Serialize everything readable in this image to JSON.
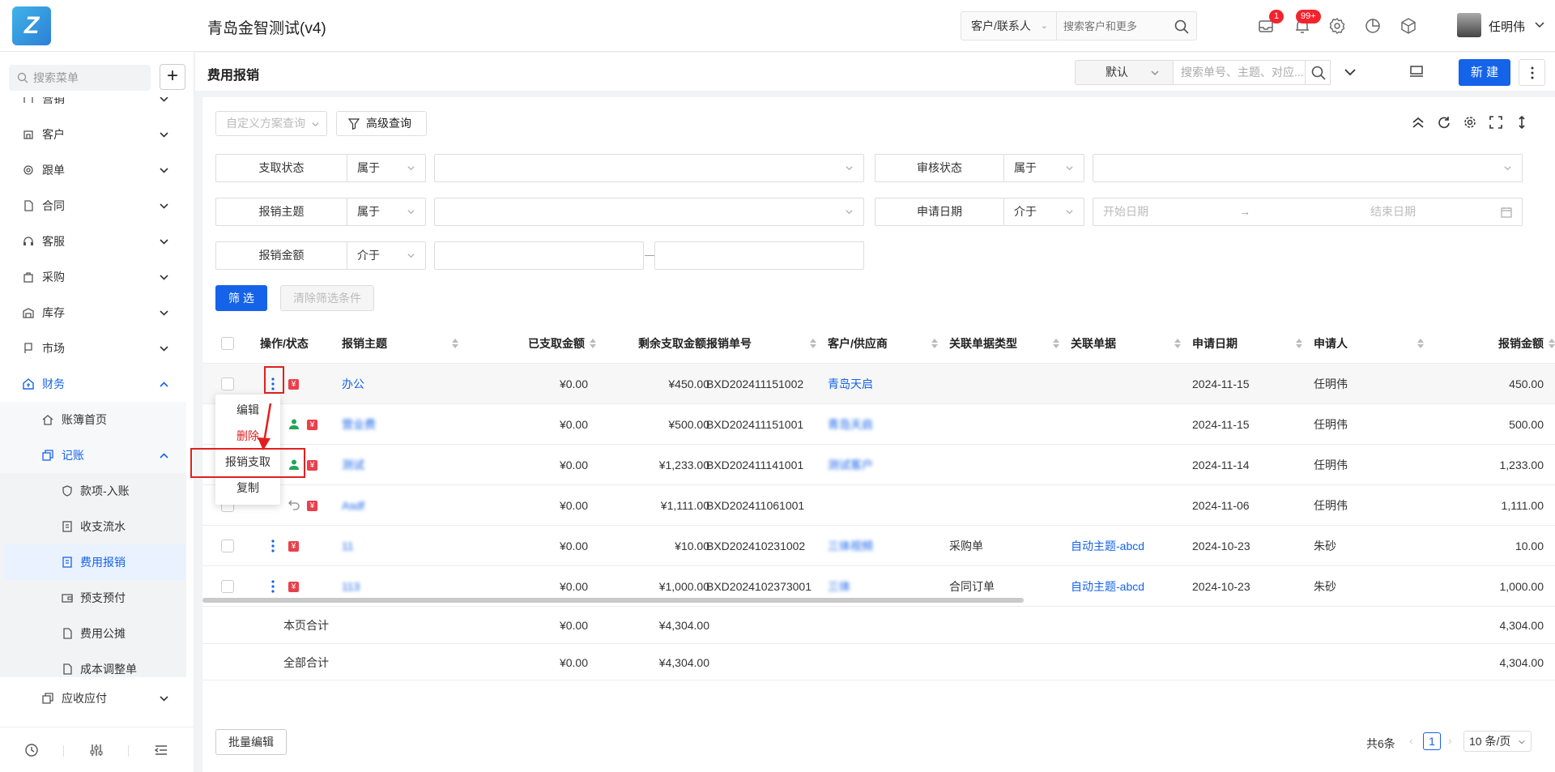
{
  "app": {
    "title": "青岛金智测试(v4)"
  },
  "header": {
    "search_type": "客户/联系人",
    "search_placeholder": "搜索客户和更多",
    "badges": [
      "1",
      "99+"
    ],
    "user_name": "任明伟",
    "icons": [
      "message-icon",
      "bell-icon",
      "settings-icon",
      "chart-icon",
      "cube-icon"
    ]
  },
  "sidebar": {
    "search_placeholder": "搜索菜单",
    "items": [
      {
        "label": "营销"
      },
      {
        "label": "客户"
      },
      {
        "label": "跟单"
      },
      {
        "label": "合同"
      },
      {
        "label": "客服"
      },
      {
        "label": "采购"
      },
      {
        "label": "库存"
      },
      {
        "label": "市场"
      },
      {
        "label": "财务"
      }
    ],
    "finance_sub": [
      {
        "label": "账簿首页"
      },
      {
        "label": "记账"
      }
    ],
    "accounting_sub": [
      {
        "label": "款项-入账"
      },
      {
        "label": "收支流水"
      },
      {
        "label": "费用报销"
      },
      {
        "label": "预支预付"
      },
      {
        "label": "费用公摊"
      },
      {
        "label": "成本调整单"
      }
    ],
    "after": {
      "label": "应收应付"
    }
  },
  "page": {
    "title": "费用报销",
    "view_select": "默认",
    "search_placeholder": "搜索单号、主题、对应...",
    "new_button": "新 建"
  },
  "filters": {
    "custom_scheme_placeholder": "自定义方案查询",
    "advanced": "高级查询",
    "rows": [
      {
        "label": "支取状态",
        "op": "属于"
      },
      {
        "label": "审核状态",
        "op": "属于"
      },
      {
        "label": "报销主题",
        "op": "属于"
      },
      {
        "label": "申请日期",
        "op": "介于"
      },
      {
        "label": "报销金额",
        "op": "介于"
      }
    ],
    "date_start": "开始日期",
    "date_end": "结束日期",
    "range_sep": "—",
    "date_arrow": "→",
    "filter_button": "筛 选",
    "clear_button": "清除筛选条件"
  },
  "table": {
    "columns": [
      "操作/状态",
      "报销主题",
      "已支取金额",
      "剩余支取金额",
      "报销单号",
      "客户/供应商",
      "关联单据类型",
      "关联单据",
      "申请日期",
      "申请人",
      "报销金额"
    ],
    "rows": [
      {
        "subject": "办公",
        "paid": "¥0.00",
        "remain": "¥450.00",
        "no": "BXD202411151002",
        "customer": "青岛天启",
        "reltype": "",
        "rel": "",
        "date": "2024-11-15",
        "applicant": "任明伟",
        "amount": "450.00"
      },
      {
        "subject": "营业费",
        "paid": "¥0.00",
        "remain": "¥500.00",
        "no": "BXD202411151001",
        "customer": "青岛天启",
        "reltype": "",
        "rel": "",
        "date": "2024-11-15",
        "applicant": "任明伟",
        "amount": "500.00"
      },
      {
        "subject": "测试",
        "paid": "¥0.00",
        "remain": "¥1,233.00",
        "no": "BXD202411141001",
        "customer": "测试客户",
        "reltype": "",
        "rel": "",
        "date": "2024-11-14",
        "applicant": "任明伟",
        "amount": "1,233.00"
      },
      {
        "subject": "Asdf",
        "paid": "¥0.00",
        "remain": "¥1,111.00",
        "no": "BXD202411061001",
        "customer": "",
        "reltype": "",
        "rel": "",
        "date": "2024-11-06",
        "applicant": "任明伟",
        "amount": "1,111.00"
      },
      {
        "subject": "11",
        "paid": "¥0.00",
        "remain": "¥10.00",
        "no": "BXD202410231002",
        "customer": "三体视频",
        "reltype": "采购单",
        "rel": "自动主题-abcd",
        "date": "2024-10-23",
        "applicant": "朱砂",
        "amount": "10.00"
      },
      {
        "subject": "113",
        "paid": "¥0.00",
        "remain": "¥1,000.00",
        "no": "BXD2024102373001",
        "customer": "三体",
        "reltype": "合同订单",
        "rel": "自动主题-abcd",
        "date": "2024-10-23",
        "applicant": "朱砂",
        "amount": "1,000.00"
      }
    ],
    "totals": [
      {
        "label": "本页合计",
        "paid": "¥0.00",
        "remain": "¥4,304.00",
        "amount": "4,304.00"
      },
      {
        "label": "全部合计",
        "paid": "¥0.00",
        "remain": "¥4,304.00",
        "amount": "4,304.00"
      }
    ]
  },
  "row_menu": {
    "items": [
      "编辑",
      "删除",
      "报销支取",
      "复制"
    ]
  },
  "footer": {
    "batch_edit": "批量编辑",
    "total": "共6条",
    "page": "1",
    "page_size": "10 条/页"
  },
  "colors": {
    "primary": "#1563e9",
    "danger": "#e8414d",
    "annotation": "#e02020",
    "green": "#23a55a"
  }
}
